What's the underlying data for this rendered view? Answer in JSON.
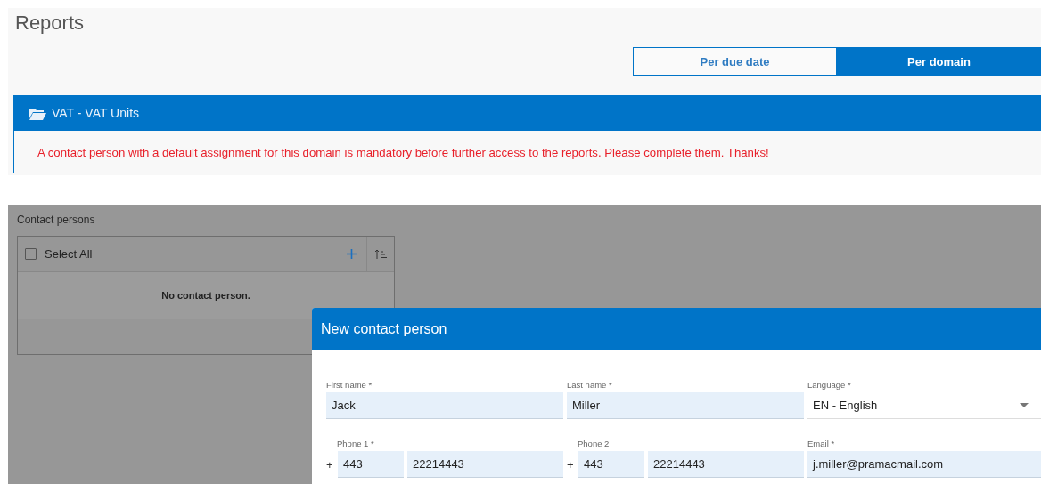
{
  "page": {
    "title": "Reports"
  },
  "view_toggle": [
    {
      "label": "Per due date",
      "selected": false
    },
    {
      "label": "Per domain",
      "selected": true
    }
  ],
  "domain": {
    "title": "VAT - VAT Units",
    "message": "A contact person with a default assignment for this domain is mandatory before further access to the reports. Please complete them. Thanks!"
  },
  "contact_persons": {
    "title": "Contact persons",
    "select_all": {
      "label": "Select All",
      "checked": false
    },
    "empty_text": "No contact person."
  },
  "dialog": {
    "title": "New contact person",
    "fields": [
      {
        "kind": "text",
        "label": "First name *",
        "value": "Jack"
      },
      {
        "kind": "text",
        "label": "Last name *",
        "value": "Miller"
      },
      {
        "kind": "select",
        "label": "Language *",
        "value": "EN - English"
      },
      {
        "kind": "phone",
        "label": "Phone 1 *",
        "prefix": "+",
        "code": "443",
        "number": "22214443"
      },
      {
        "kind": "phone",
        "label": "Phone 2",
        "prefix": "+",
        "code": "443",
        "number": "22214443"
      },
      {
        "kind": "text",
        "label": "Email *",
        "value": "j.miller@pramacmail.com"
      }
    ]
  }
}
